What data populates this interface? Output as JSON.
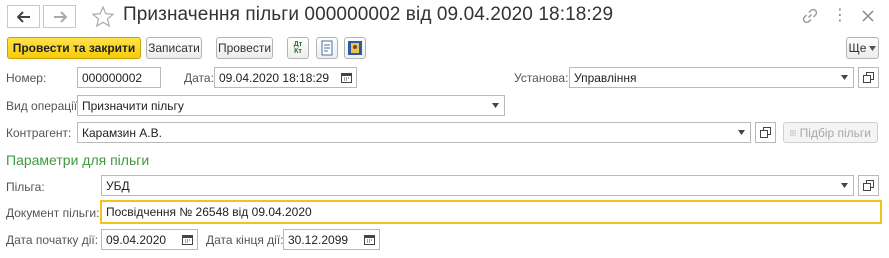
{
  "window": {
    "title": "Призначення пільги 000000002 від 09.04.2020 18:18:29"
  },
  "toolbar": {
    "post_close_label": "Провести та закрити",
    "save_label": "Записати",
    "post_label": "Провести",
    "dtkt_icon_text": "Дт Кт",
    "more_label": "Ще"
  },
  "form": {
    "number_label": "Номер:",
    "number_value": "000000002",
    "date_label": "Дата:",
    "date_value": "09.04.2020 18:18:29",
    "institution_label": "Установа:",
    "institution_value": "Управління",
    "operation_label": "Вид операції:",
    "operation_value": "Призначити пільгу",
    "counterparty_label": "Контрагент:",
    "counterparty_value": "Карамзин А.В.",
    "select_benefit_label": "Підбір пільги",
    "section_title": "Параметри для пільги",
    "benefit_label": "Пільга:",
    "benefit_value": "УБД",
    "document_label": "Документ пільги:",
    "document_value": "Посвідчення № 26548 від 09.04.2020",
    "start_date_label": "Дата початку дії:",
    "start_date_value": "09.04.2020",
    "end_date_label": "Дата кінця дії:",
    "end_date_value": "30.12.2099"
  },
  "colors": {
    "primary_button": "#f5cc0a",
    "section_title": "#3f9a3f",
    "focus_border": "#f0c419"
  }
}
